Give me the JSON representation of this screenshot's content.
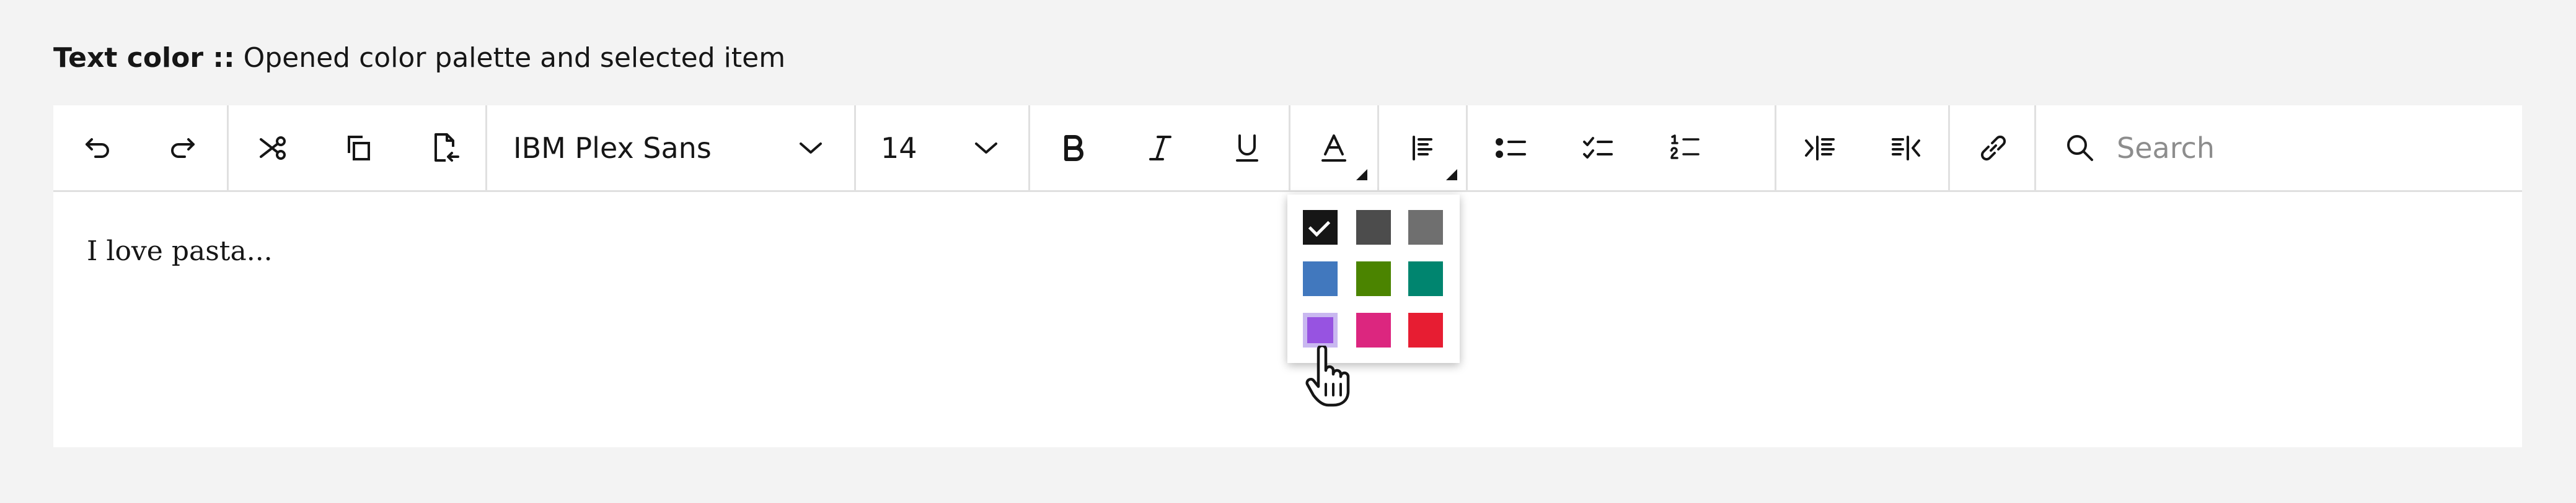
{
  "caption": {
    "title": "Text color ::",
    "description": "Opened color palette and selected item"
  },
  "toolbar": {
    "undo_icon": "undo-icon",
    "redo_icon": "redo-icon",
    "cut_icon": "scissors-icon",
    "copy_icon": "copy-icon",
    "paste_icon": "paste-icon",
    "font_family": "IBM Plex Sans",
    "font_size": "14",
    "bold_icon": "bold-icon",
    "italic_icon": "italic-icon",
    "underline_icon": "underline-icon",
    "text_color_icon": "text-color-icon",
    "align_icon": "align-left-icon",
    "bullet_list_icon": "bullet-list-icon",
    "checklist_icon": "checklist-icon",
    "numbered_list_icon": "numbered-list-icon",
    "indent_icon": "indent-icon",
    "outdent_icon": "outdent-icon",
    "link_icon": "link-icon",
    "search_placeholder": "Search"
  },
  "editor": {
    "content": "I love pasta..."
  },
  "palette": {
    "colors": [
      "#161616",
      "#4c4c4c",
      "#6f6f6f",
      "#4178be",
      "#4b8400",
      "#00856f",
      "#9753e1",
      "#dc267f",
      "#e71d32"
    ],
    "checked_index": 0,
    "hovered_index": 6,
    "hover_ring_color": "#c9b8f0"
  }
}
